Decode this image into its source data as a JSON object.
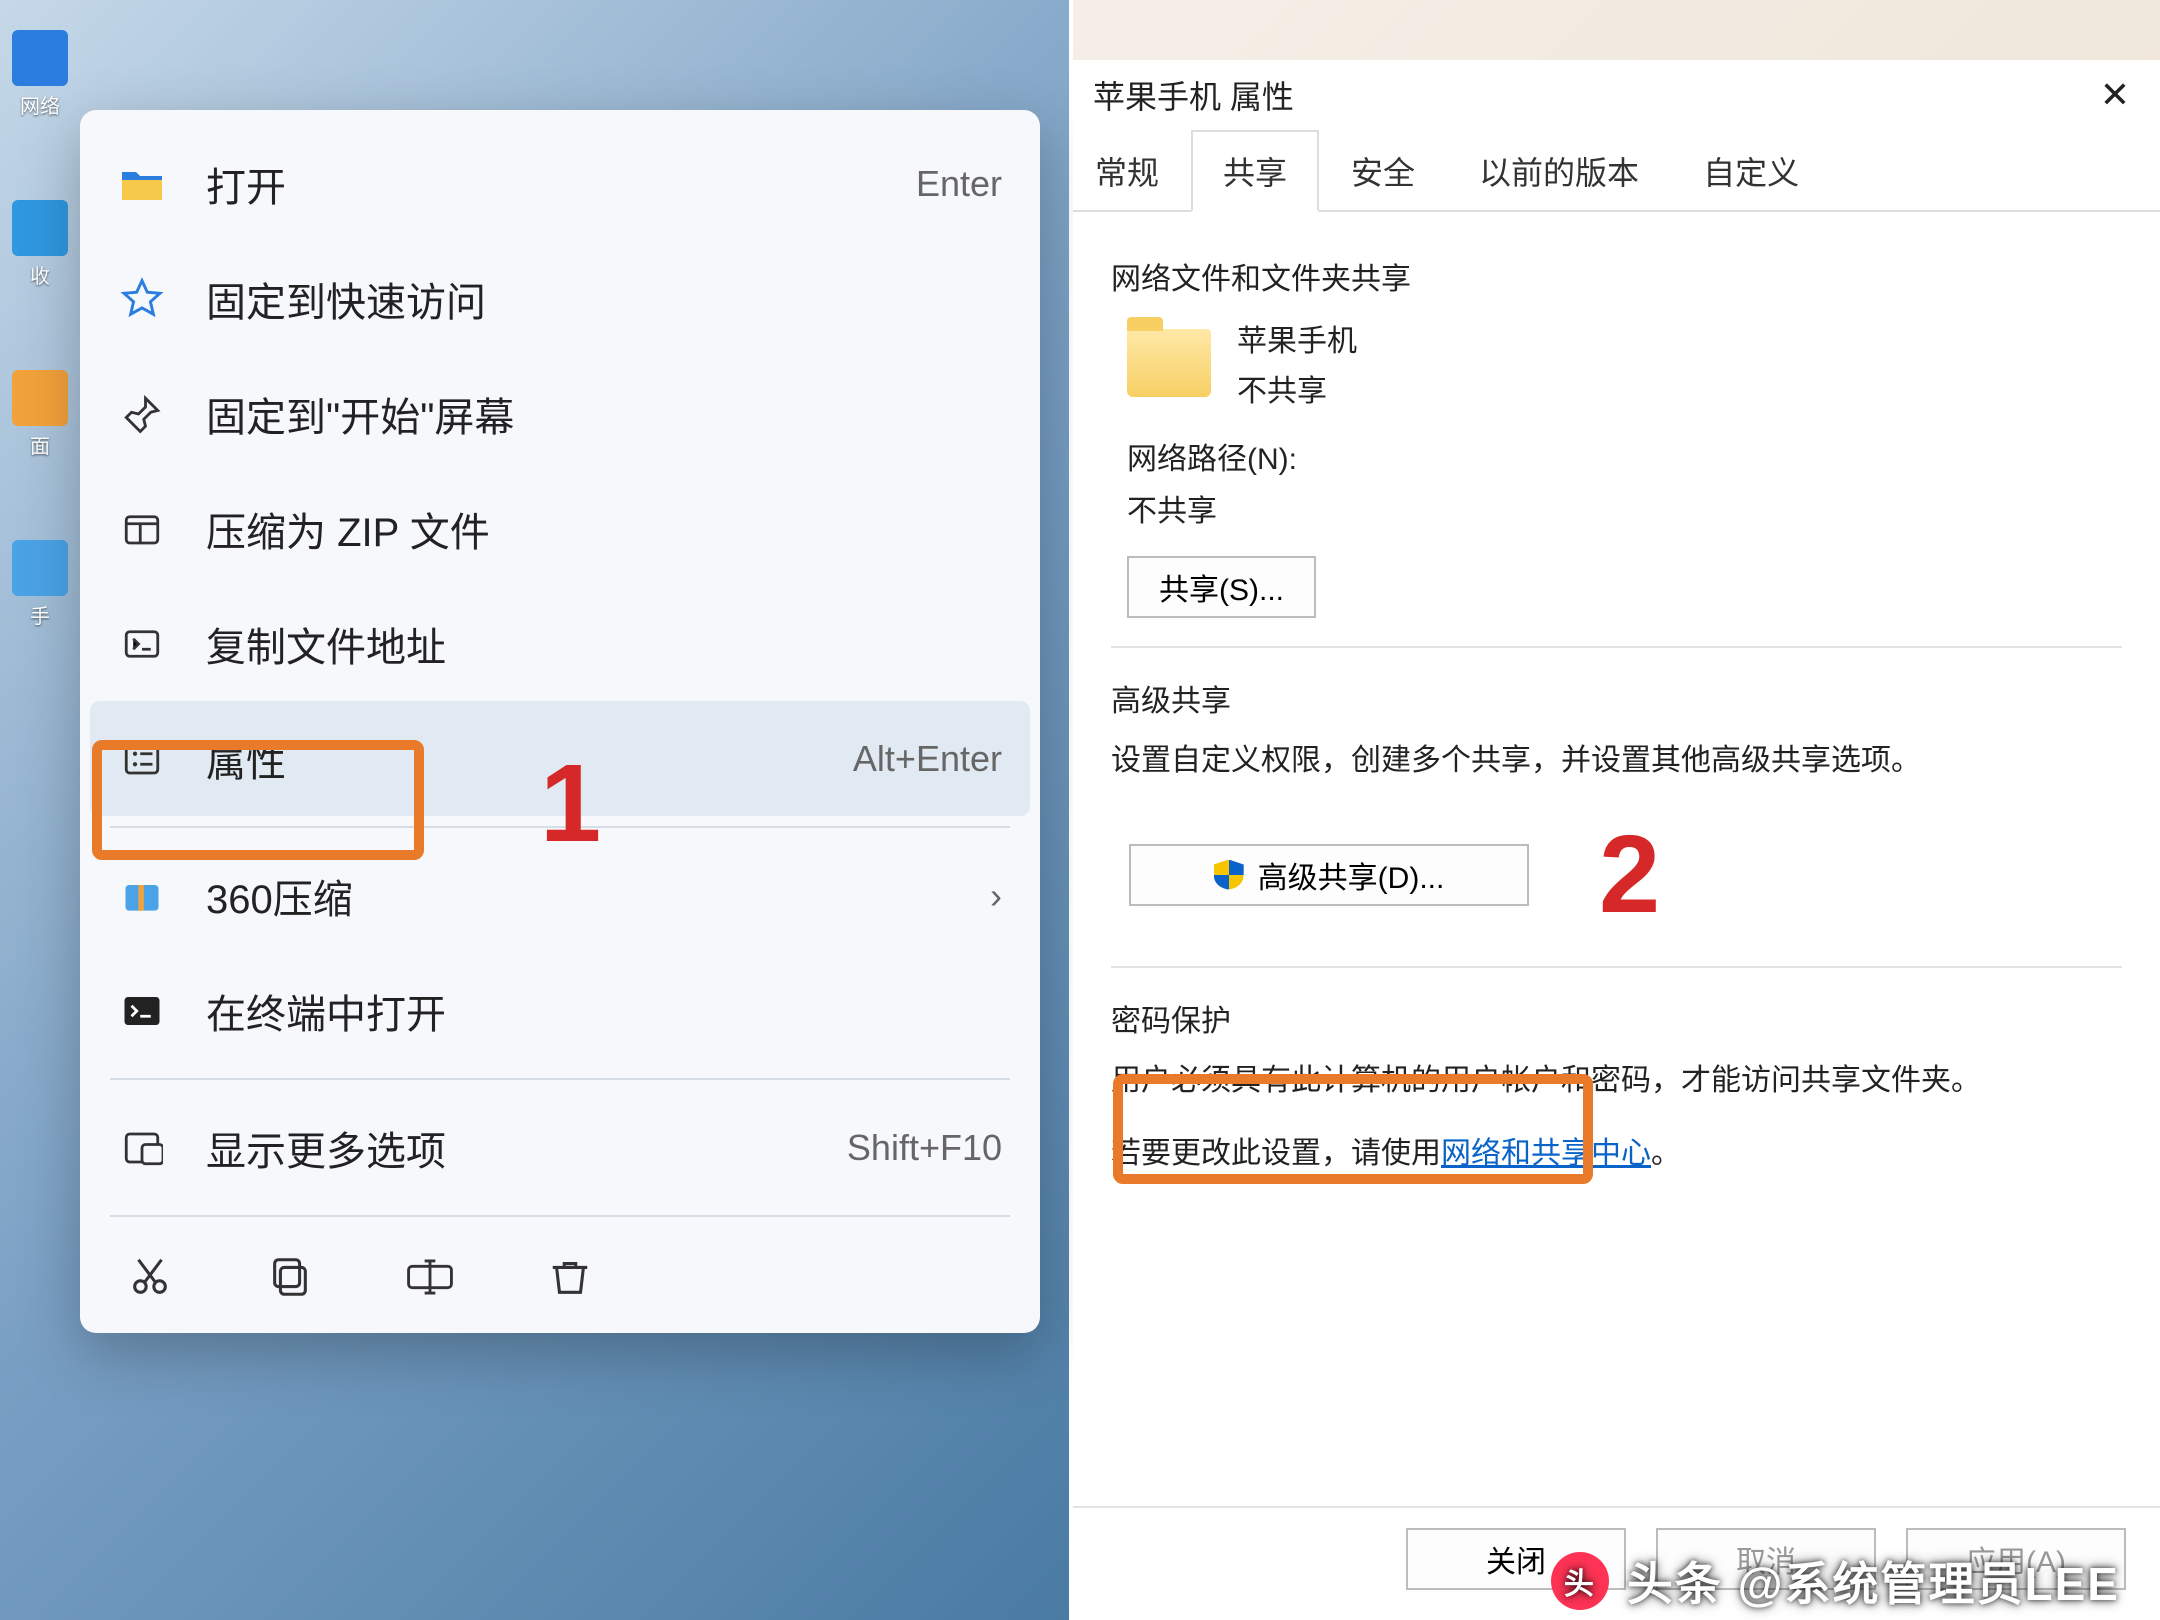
{
  "left": {
    "desktop_icons": [
      {
        "label": "网络",
        "color": "#2b7de0"
      },
      {
        "label": "收",
        "color": "#2f98e0"
      },
      {
        "label": "面",
        "color": "#f2a23a"
      },
      {
        "label": "手",
        "color": "#4aa3e6"
      }
    ],
    "context_menu": {
      "items": [
        {
          "icon": "folder-open-icon",
          "label": "打开",
          "hint": "Enter"
        },
        {
          "icon": "star-icon",
          "label": "固定到快速访问",
          "hint": ""
        },
        {
          "icon": "pin-icon",
          "label": "固定到\"开始\"屏幕",
          "hint": ""
        },
        {
          "icon": "archive-icon",
          "label": "压缩为 ZIP 文件",
          "hint": ""
        },
        {
          "icon": "copy-path-icon",
          "label": "复制文件地址",
          "hint": ""
        },
        {
          "icon": "properties-icon",
          "label": "属性",
          "hint": "Alt+Enter",
          "highlight": true
        }
      ],
      "items2": [
        {
          "icon": "360zip-icon",
          "label": "360压缩",
          "hint": "›"
        },
        {
          "icon": "terminal-icon",
          "label": "在终端中打开",
          "hint": ""
        }
      ],
      "more": {
        "icon": "more-icon",
        "label": "显示更多选项",
        "hint": "Shift+F10"
      },
      "toolbar": [
        {
          "name": "cut-icon"
        },
        {
          "name": "copy-icon"
        },
        {
          "name": "rename-icon"
        },
        {
          "name": "delete-icon"
        }
      ]
    },
    "callout_number": "1"
  },
  "right": {
    "title": "苹果手机 属性",
    "tabs": [
      {
        "label": "常规",
        "cropped": true
      },
      {
        "label": "共享",
        "active": true
      },
      {
        "label": "安全"
      },
      {
        "label": "以前的版本"
      },
      {
        "label": "自定义"
      }
    ],
    "share": {
      "section_title": "网络文件和文件夹共享",
      "folder_name": "苹果手机",
      "folder_status": "不共享",
      "network_path_label": "网络路径(N):",
      "network_path_value": "不共享",
      "share_button": "共享(S)...",
      "adv_title": "高级共享",
      "adv_desc": "设置自定义权限，创建多个共享，并设置其他高级共享选项。",
      "adv_button": "高级共享(D)...",
      "pw_title": "密码保护",
      "pw_desc": "用户必须具有此计算机的用户帐户和密码，才能访问共享文件夹。",
      "pw_change_prefix": "若要更改此设置，请使用",
      "pw_link": "网络和共享中心",
      "pw_change_suffix": "。"
    },
    "footer": {
      "close": "关闭",
      "cancel": "取消",
      "apply": "应用(A)"
    },
    "callout_number": "2"
  },
  "watermark": "头条 @系统管理员LEE"
}
